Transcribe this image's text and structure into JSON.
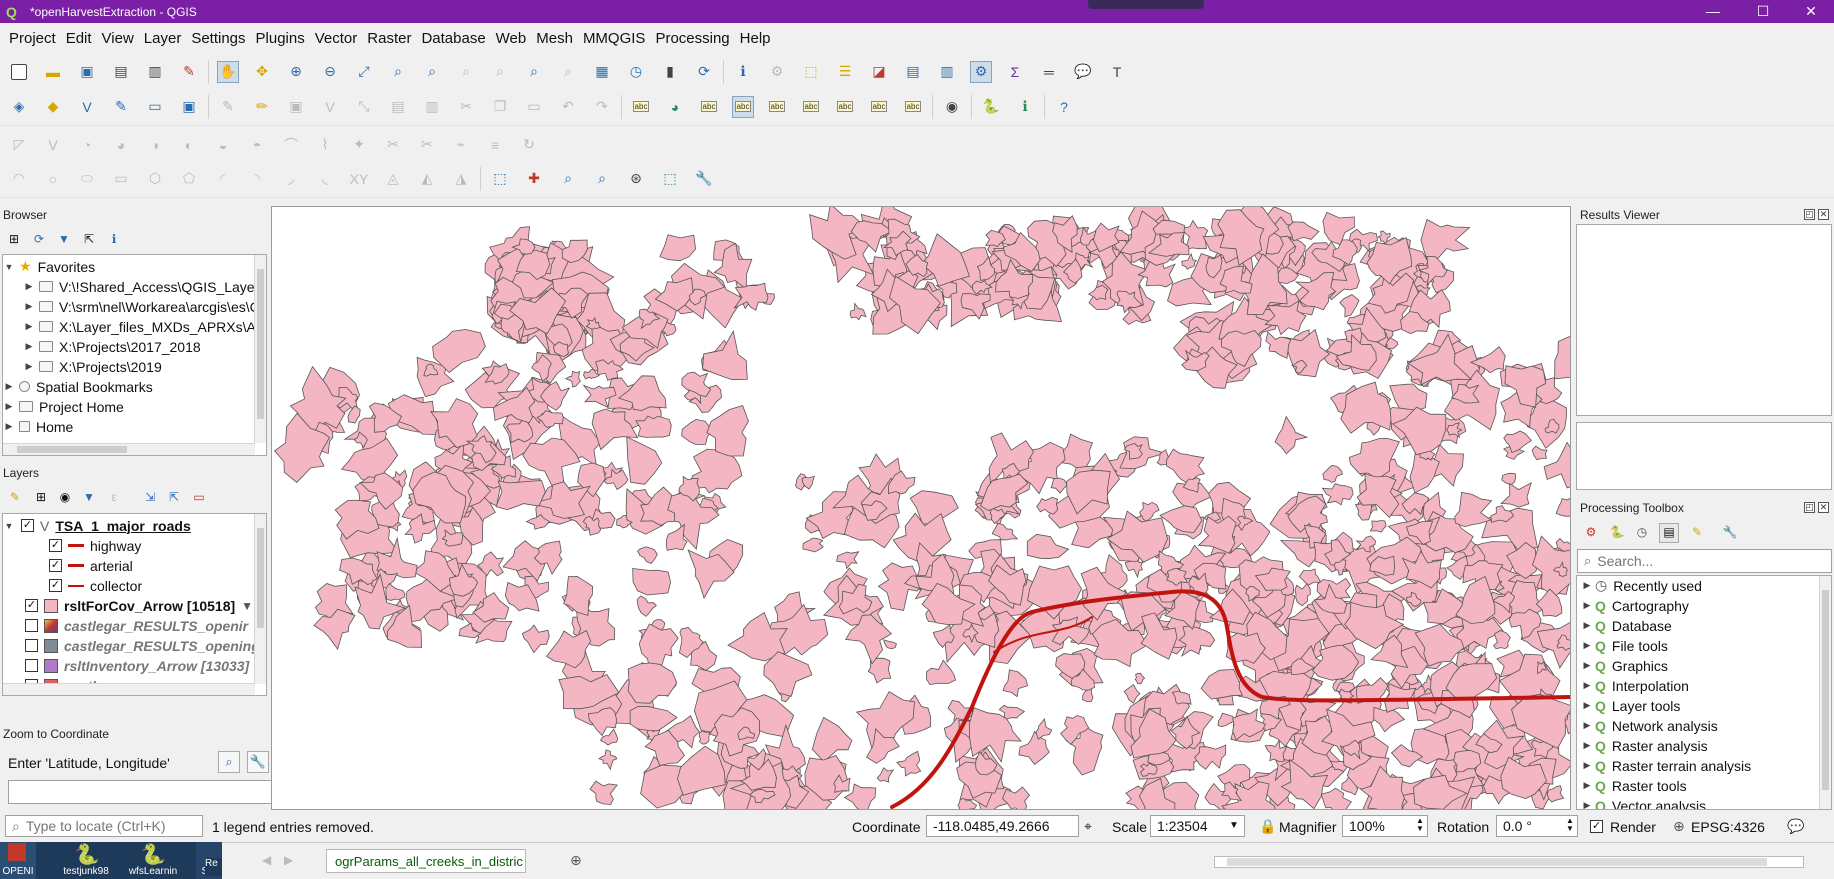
{
  "window": {
    "title": "*openHarvestExtraction - QGIS",
    "app_icon": "Q",
    "minimize": "—",
    "maximize": "☐",
    "close": "✕"
  },
  "menu": [
    "Project",
    "Edit",
    "View",
    "Layer",
    "Settings",
    "Plugins",
    "Vector",
    "Raster",
    "Database",
    "Web",
    "Mesh",
    "MMQGIS",
    "Processing",
    "Help"
  ],
  "browser": {
    "title": "Browser",
    "items": [
      {
        "label": "Favorites",
        "icon": "star-icon",
        "expanded": true,
        "level": 0
      },
      {
        "label": "V:\\!Shared_Access\\QGIS_Layer_Lib",
        "icon": "folder-icon",
        "level": 1
      },
      {
        "label": "V:\\srm\\nel\\Workarea\\arcgis\\es\\Cur",
        "icon": "folder-icon",
        "level": 1
      },
      {
        "label": "X:\\Layer_files_MXDs_APRXs\\ArcGIS",
        "icon": "folder-icon",
        "level": 1
      },
      {
        "label": "X:\\Projects\\2017_2018",
        "icon": "folder-icon",
        "level": 1
      },
      {
        "label": "X:\\Projects\\2019",
        "icon": "folder-icon",
        "level": 1
      },
      {
        "label": "Spatial Bookmarks",
        "icon": "bookmark-icon",
        "level": 0
      },
      {
        "label": "Project Home",
        "icon": "folder-icon",
        "level": 0
      },
      {
        "label": "Home",
        "icon": "home-icon",
        "level": 0
      }
    ]
  },
  "layers": {
    "title": "Layers",
    "items": [
      {
        "label": "TSA_1_major_roads",
        "checked": true,
        "bold": true,
        "underline": true,
        "symbol": "line-layer",
        "level": 0
      },
      {
        "label": "highway",
        "checked": true,
        "symbol": "line",
        "color": "#c0150f",
        "level": 1
      },
      {
        "label": "arterial",
        "checked": true,
        "symbol": "line",
        "color": "#c0150f",
        "level": 1
      },
      {
        "label": "collector",
        "checked": true,
        "symbol": "line-thin",
        "color": "#c0150f",
        "level": 1
      },
      {
        "label": "rsltForCov_Arrow [10518]",
        "checked": true,
        "bold": true,
        "symbol": "fill",
        "color": "#f4b6c2",
        "level": 0
      },
      {
        "label": "castlegar_RESULTS_openir",
        "checked": false,
        "italic": true,
        "symbol": "gradient",
        "color": "#6a3a9c",
        "level": 0
      },
      {
        "label": "castlegar_RESULTS_openings",
        "checked": false,
        "italic": true,
        "symbol": "fill",
        "color": "#7f8c99",
        "level": 0
      },
      {
        "label": "rsltInventory_Arrow [13033]",
        "checked": false,
        "italic": true,
        "symbol": "fill",
        "color": "#b07ac9",
        "level": 0
      },
      {
        "label": "castlegar",
        "checked": false,
        "italic": true,
        "symbol": "fill",
        "color": "#e06060",
        "level": 0
      }
    ]
  },
  "zoom_to_coordinate": {
    "title": "Zoom to Coordinate",
    "label": "Enter 'Latitude, Longitude'",
    "value": ""
  },
  "results_viewer": {
    "title": "Results Viewer"
  },
  "processing_toolbox": {
    "title": "Processing Toolbox",
    "search_placeholder": "Search...",
    "items": [
      "Recently used",
      "Cartography",
      "Database",
      "File tools",
      "Graphics",
      "Interpolation",
      "Layer tools",
      "Network analysis",
      "Raster analysis",
      "Raster terrain analysis",
      "Raster tools",
      "Vector analysis"
    ]
  },
  "statusbar": {
    "locate_placeholder": "Type to locate (Ctrl+K)",
    "message": "1 legend entries removed.",
    "coordinate_label": "Coordinate",
    "coordinate_value": "-118.0485,49.2666",
    "scale_label": "Scale",
    "scale_value": "1:23504",
    "magnifier_label": "Magnifier",
    "magnifier_value": "100%",
    "rotation_label": "Rotation",
    "rotation_value": "0.0 °",
    "render_label": "Render",
    "render_checked": true,
    "crs": "EPSG:4326"
  },
  "taskbar": {
    "items": [
      "OPENI",
      "testjunk98",
      "wfsLearnin",
      "Set",
      "Re"
    ],
    "tab_label": "ogrParams_all_creeks_in_distric"
  },
  "colors": {
    "title_bar": "#7a1fa6",
    "polygon_fill": "#f4b6c2",
    "polygon_stroke": "#555555",
    "road": "#c0150f"
  }
}
